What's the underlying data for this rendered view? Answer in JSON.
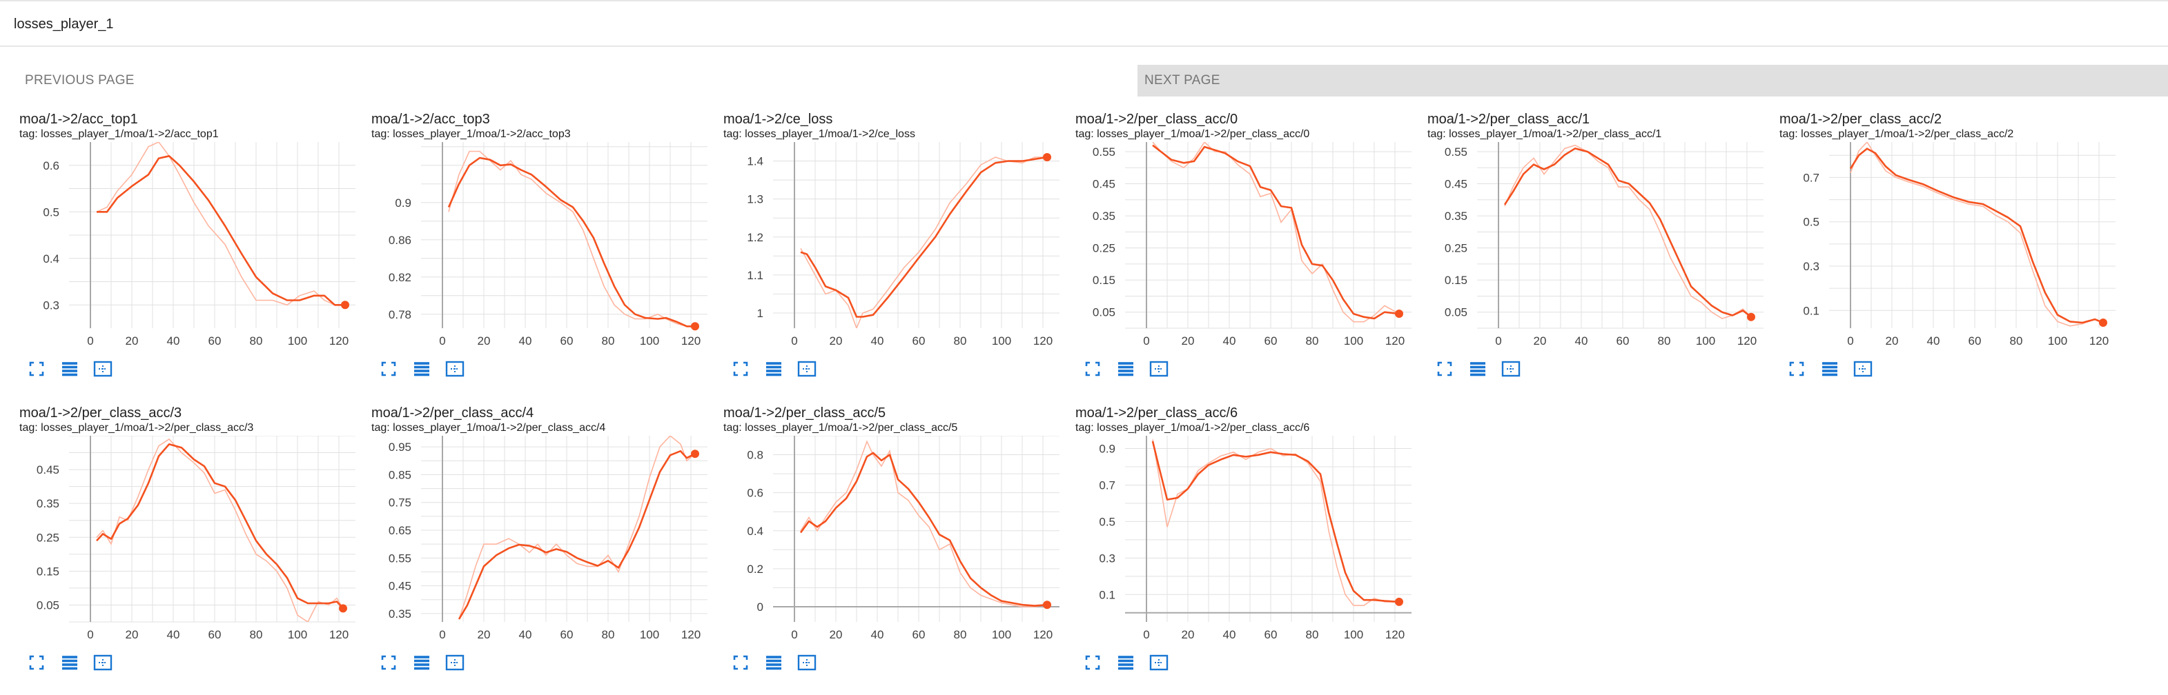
{
  "header": {
    "title": "losses_player_1"
  },
  "pager": {
    "prev_label": "PREVIOUS PAGE",
    "next_label": "NEXT PAGE"
  },
  "colors": {
    "smoothed": "#f4511e",
    "raw": "#ffb59f",
    "grid": "#e0e0e0",
    "axis": "#a8a8a8",
    "icon": "#1976d2"
  },
  "cards": [
    {
      "title": "moa/1->2/acc_top1",
      "tag": "tag: losses_player_1/moa/1->2/acc_top1",
      "icons": [
        "fullscreen-icon",
        "data-list-icon",
        "fit-domain-icon"
      ]
    },
    {
      "title": "moa/1->2/acc_top3",
      "tag": "tag: losses_player_1/moa/1->2/acc_top3",
      "icons": [
        "fullscreen-icon",
        "data-list-icon",
        "fit-domain-icon"
      ]
    },
    {
      "title": "moa/1->2/ce_loss",
      "tag": "tag: losses_player_1/moa/1->2/ce_loss",
      "icons": [
        "fullscreen-icon",
        "data-list-icon",
        "fit-domain-icon"
      ]
    },
    {
      "title": "moa/1->2/per_class_acc/0",
      "tag": "tag: losses_player_1/moa/1->2/per_class_acc/0",
      "icons": [
        "fullscreen-icon",
        "data-list-icon",
        "fit-domain-icon"
      ]
    },
    {
      "title": "moa/1->2/per_class_acc/1",
      "tag": "tag: losses_player_1/moa/1->2/per_class_acc/1",
      "icons": [
        "fullscreen-icon",
        "data-list-icon",
        "fit-domain-icon"
      ]
    },
    {
      "title": "moa/1->2/per_class_acc/2",
      "tag": "tag: losses_player_1/moa/1->2/per_class_acc/2",
      "icons": [
        "fullscreen-icon",
        "data-list-icon",
        "fit-domain-icon"
      ]
    },
    {
      "title": "moa/1->2/per_class_acc/3",
      "tag": "tag: losses_player_1/moa/1->2/per_class_acc/3",
      "icons": [
        "fullscreen-icon",
        "data-list-icon",
        "fit-domain-icon"
      ]
    },
    {
      "title": "moa/1->2/per_class_acc/4",
      "tag": "tag: losses_player_1/moa/1->2/per_class_acc/4",
      "icons": [
        "fullscreen-icon",
        "data-list-icon",
        "fit-domain-icon"
      ]
    },
    {
      "title": "moa/1->2/per_class_acc/5",
      "tag": "tag: losses_player_1/moa/1->2/per_class_acc/5",
      "icons": [
        "fullscreen-icon",
        "data-list-icon",
        "fit-domain-icon"
      ]
    },
    {
      "title": "moa/1->2/per_class_acc/6",
      "tag": "tag: losses_player_1/moa/1->2/per_class_acc/6",
      "icons": [
        "fullscreen-icon",
        "data-list-icon",
        "fit-domain-icon"
      ]
    }
  ],
  "chart_data": [
    {
      "type": "line",
      "title": "moa/1->2/acc_top1",
      "xlim": [
        -7,
        128
      ],
      "ylim": [
        0.25,
        0.65
      ],
      "xticks": [
        0,
        20,
        40,
        60,
        80,
        100,
        120
      ],
      "yticks": [
        0.3,
        0.4,
        0.5,
        0.6
      ],
      "ytick_labels": [
        "0.3",
        "0.4",
        "0.5",
        "0.6"
      ],
      "grid": true,
      "x": [
        3,
        8,
        13,
        20,
        28,
        33,
        38,
        43,
        50,
        57,
        65,
        73,
        80,
        88,
        95,
        101,
        108,
        113,
        118,
        123
      ],
      "smoothed": [
        0.5,
        0.5,
        0.53,
        0.555,
        0.58,
        0.615,
        0.62,
        0.6,
        0.565,
        0.525,
        0.47,
        0.41,
        0.36,
        0.325,
        0.31,
        0.31,
        0.32,
        0.32,
        0.3,
        0.3
      ],
      "raw": [
        0.5,
        0.51,
        0.545,
        0.58,
        0.64,
        0.65,
        0.62,
        0.58,
        0.52,
        0.47,
        0.43,
        0.36,
        0.31,
        0.31,
        0.3,
        0.32,
        0.33,
        0.31,
        0.3,
        0.3
      ]
    },
    {
      "type": "line",
      "title": "moa/1->2/acc_top3",
      "xlim": [
        -7,
        128
      ],
      "ylim": [
        0.765,
        0.965
      ],
      "xticks": [
        0,
        20,
        40,
        60,
        80,
        100,
        120
      ],
      "yticks": [
        0.78,
        0.82,
        0.86,
        0.9
      ],
      "ytick_labels": [
        "0.78",
        "0.82",
        "0.86",
        "0.9"
      ],
      "grid": true,
      "x": [
        3,
        8,
        13,
        18,
        23,
        28,
        33,
        38,
        43,
        50,
        57,
        63,
        68,
        73,
        78,
        83,
        88,
        93,
        98,
        104,
        108,
        113,
        118,
        122
      ],
      "smoothed": [
        0.895,
        0.92,
        0.94,
        0.948,
        0.946,
        0.94,
        0.941,
        0.935,
        0.93,
        0.917,
        0.903,
        0.895,
        0.88,
        0.862,
        0.835,
        0.81,
        0.79,
        0.78,
        0.776,
        0.775,
        0.776,
        0.772,
        0.767,
        0.767
      ],
      "raw": [
        0.89,
        0.93,
        0.955,
        0.955,
        0.945,
        0.935,
        0.945,
        0.93,
        0.925,
        0.91,
        0.9,
        0.89,
        0.87,
        0.84,
        0.81,
        0.79,
        0.78,
        0.775,
        0.775,
        0.78,
        0.775,
        0.77,
        0.767,
        0.767
      ]
    },
    {
      "type": "line",
      "title": "moa/1->2/ce_loss",
      "xlim": [
        -7,
        128
      ],
      "ylim": [
        0.96,
        1.45
      ],
      "xticks": [
        0,
        20,
        40,
        60,
        80,
        100,
        120
      ],
      "yticks": [
        1,
        1.1,
        1.2,
        1.3,
        1.4
      ],
      "ytick_labels": [
        "1",
        "1.1",
        "1.2",
        "1.3",
        "1.4"
      ],
      "grid": true,
      "x": [
        3,
        6,
        10,
        15,
        20,
        26,
        30,
        33,
        38,
        45,
        53,
        60,
        68,
        75,
        83,
        90,
        97,
        103,
        110,
        116,
        122
      ],
      "smoothed": [
        1.16,
        1.155,
        1.12,
        1.07,
        1.06,
        1.04,
        0.99,
        0.99,
        0.995,
        1.04,
        1.095,
        1.145,
        1.2,
        1.26,
        1.32,
        1.37,
        1.395,
        1.4,
        1.4,
        1.405,
        1.41
      ],
      "raw": [
        1.17,
        1.14,
        1.1,
        1.05,
        1.06,
        1.02,
        0.96,
        1.0,
        1.01,
        1.06,
        1.12,
        1.16,
        1.22,
        1.29,
        1.34,
        1.39,
        1.41,
        1.4,
        1.395,
        1.41,
        1.41
      ]
    },
    {
      "type": "line",
      "title": "moa/1->2/per_class_acc/0",
      "xlim": [
        -7,
        128
      ],
      "ylim": [
        0.0,
        0.58
      ],
      "xticks": [
        0,
        20,
        40,
        60,
        80,
        100,
        120
      ],
      "yticks": [
        0.05,
        0.15,
        0.25,
        0.35,
        0.45,
        0.55
      ],
      "ytick_labels": [
        "0.05",
        "0.15",
        "0.25",
        "0.35",
        "0.45",
        "0.55"
      ],
      "grid": true,
      "x": [
        3,
        7,
        12,
        18,
        23,
        28,
        33,
        38,
        44,
        50,
        55,
        60,
        65,
        70,
        75,
        80,
        85,
        90,
        95,
        100,
        105,
        110,
        115,
        122
      ],
      "smoothed": [
        0.57,
        0.55,
        0.525,
        0.515,
        0.52,
        0.565,
        0.555,
        0.545,
        0.52,
        0.505,
        0.44,
        0.43,
        0.38,
        0.375,
        0.26,
        0.2,
        0.195,
        0.15,
        0.09,
        0.045,
        0.035,
        0.03,
        0.05,
        0.045
      ],
      "raw": [
        0.58,
        0.55,
        0.52,
        0.5,
        0.53,
        0.58,
        0.55,
        0.55,
        0.51,
        0.48,
        0.41,
        0.42,
        0.33,
        0.37,
        0.21,
        0.17,
        0.2,
        0.12,
        0.05,
        0.02,
        0.02,
        0.04,
        0.07,
        0.045
      ]
    },
    {
      "type": "line",
      "title": "moa/1->2/per_class_acc/1",
      "xlim": [
        -7,
        128
      ],
      "ylim": [
        0.0,
        0.58
      ],
      "xticks": [
        0,
        20,
        40,
        60,
        80,
        100,
        120
      ],
      "yticks": [
        0.05,
        0.15,
        0.25,
        0.35,
        0.45,
        0.55
      ],
      "ytick_labels": [
        "0.05",
        "0.15",
        "0.25",
        "0.35",
        "0.45",
        "0.55"
      ],
      "grid": true,
      "x": [
        3,
        7,
        12,
        17,
        22,
        27,
        32,
        37,
        43,
        48,
        53,
        58,
        63,
        68,
        73,
        78,
        83,
        88,
        93,
        98,
        103,
        108,
        113,
        118,
        122
      ],
      "smoothed": [
        0.385,
        0.425,
        0.48,
        0.51,
        0.495,
        0.51,
        0.54,
        0.56,
        0.55,
        0.53,
        0.51,
        0.46,
        0.45,
        0.42,
        0.39,
        0.34,
        0.27,
        0.2,
        0.13,
        0.1,
        0.07,
        0.05,
        0.04,
        0.055,
        0.035
      ],
      "raw": [
        0.38,
        0.44,
        0.5,
        0.53,
        0.48,
        0.52,
        0.56,
        0.57,
        0.55,
        0.52,
        0.5,
        0.44,
        0.44,
        0.4,
        0.37,
        0.3,
        0.22,
        0.16,
        0.1,
        0.08,
        0.05,
        0.03,
        0.04,
        0.06,
        0.035
      ]
    },
    {
      "type": "line",
      "title": "moa/1->2/per_class_acc/2",
      "xlim": [
        -7,
        128
      ],
      "ylim": [
        0.02,
        0.86
      ],
      "xticks": [
        0,
        20,
        40,
        60,
        80,
        100,
        120
      ],
      "yticks": [
        0.1,
        0.3,
        0.5,
        0.7
      ],
      "ytick_labels": [
        "0.1",
        "0.3",
        "0.5",
        "0.7"
      ],
      "grid": true,
      "x": [
        0,
        4,
        8,
        12,
        17,
        22,
        28,
        35,
        42,
        50,
        57,
        64,
        70,
        76,
        82,
        88,
        94,
        100,
        106,
        112,
        118,
        122
      ],
      "smoothed": [
        0.74,
        0.8,
        0.83,
        0.81,
        0.75,
        0.71,
        0.69,
        0.67,
        0.64,
        0.61,
        0.59,
        0.58,
        0.55,
        0.52,
        0.48,
        0.32,
        0.18,
        0.08,
        0.05,
        0.045,
        0.06,
        0.045
      ],
      "raw": [
        0.72,
        0.82,
        0.86,
        0.8,
        0.73,
        0.7,
        0.68,
        0.66,
        0.63,
        0.6,
        0.58,
        0.57,
        0.53,
        0.5,
        0.45,
        0.28,
        0.12,
        0.05,
        0.03,
        0.04,
        0.06,
        0.045
      ]
    },
    {
      "type": "line",
      "title": "moa/1->2/per_class_acc/3",
      "xlim": [
        -7,
        128
      ],
      "ylim": [
        0.0,
        0.55
      ],
      "xticks": [
        0,
        20,
        40,
        60,
        80,
        100,
        120
      ],
      "yticks": [
        0.05,
        0.15,
        0.25,
        0.35,
        0.45
      ],
      "ytick_labels": [
        "0.05",
        "0.15",
        "0.25",
        "0.35",
        "0.45"
      ],
      "grid": true,
      "x": [
        3,
        6,
        10,
        14,
        18,
        23,
        28,
        33,
        38,
        44,
        50,
        55,
        60,
        65,
        70,
        75,
        80,
        85,
        90,
        95,
        100,
        105,
        110,
        115,
        119,
        122
      ],
      "smoothed": [
        0.24,
        0.26,
        0.245,
        0.29,
        0.305,
        0.345,
        0.41,
        0.49,
        0.525,
        0.515,
        0.48,
        0.46,
        0.41,
        0.4,
        0.36,
        0.3,
        0.24,
        0.2,
        0.17,
        0.13,
        0.07,
        0.055,
        0.055,
        0.055,
        0.06,
        0.04
      ],
      "raw": [
        0.25,
        0.27,
        0.23,
        0.31,
        0.3,
        0.37,
        0.45,
        0.52,
        0.54,
        0.5,
        0.47,
        0.44,
        0.38,
        0.39,
        0.33,
        0.26,
        0.2,
        0.18,
        0.15,
        0.1,
        0.02,
        0.0,
        0.06,
        0.05,
        0.07,
        0.04
      ]
    },
    {
      "type": "line",
      "title": "moa/1->2/per_class_acc/4",
      "xlim": [
        -7,
        128
      ],
      "ylim": [
        0.32,
        0.99
      ],
      "xticks": [
        0,
        20,
        40,
        60,
        80,
        100,
        120
      ],
      "yticks": [
        0.35,
        0.45,
        0.55,
        0.65,
        0.75,
        0.85,
        0.95
      ],
      "ytick_labels": [
        "0.35",
        "0.45",
        "0.55",
        "0.65",
        "0.75",
        "0.85",
        "0.95"
      ],
      "grid": true,
      "x": [
        8,
        12,
        16,
        20,
        26,
        32,
        37,
        42,
        46,
        50,
        55,
        60,
        65,
        70,
        75,
        80,
        85,
        90,
        95,
        100,
        105,
        110,
        115,
        118,
        122
      ],
      "smoothed": [
        0.33,
        0.38,
        0.45,
        0.52,
        0.56,
        0.585,
        0.598,
        0.594,
        0.585,
        0.57,
        0.582,
        0.572,
        0.55,
        0.535,
        0.522,
        0.54,
        0.515,
        0.58,
        0.66,
        0.76,
        0.86,
        0.92,
        0.935,
        0.91,
        0.925
      ],
      "raw": [
        0.33,
        0.42,
        0.52,
        0.6,
        0.6,
        0.62,
        0.6,
        0.57,
        0.6,
        0.56,
        0.6,
        0.56,
        0.53,
        0.52,
        0.52,
        0.56,
        0.5,
        0.6,
        0.7,
        0.84,
        0.95,
        0.99,
        0.96,
        0.9,
        0.925
      ]
    },
    {
      "type": "line",
      "title": "moa/1->2/per_class_acc/5",
      "xlim": [
        -7,
        128
      ],
      "ylim": [
        -0.08,
        0.9
      ],
      "xticks": [
        0,
        20,
        40,
        60,
        80,
        100,
        120
      ],
      "yticks": [
        0,
        0.2,
        0.4,
        0.6,
        0.8
      ],
      "ytick_labels": [
        "0",
        "0.2",
        "0.4",
        "0.6",
        "0.8"
      ],
      "grid": true,
      "x": [
        3,
        7,
        11,
        15,
        20,
        25,
        30,
        35,
        38,
        42,
        46,
        50,
        55,
        60,
        65,
        70,
        75,
        80,
        85,
        90,
        95,
        100,
        105,
        110,
        116,
        122
      ],
      "smoothed": [
        0.39,
        0.45,
        0.42,
        0.45,
        0.52,
        0.57,
        0.66,
        0.79,
        0.81,
        0.77,
        0.8,
        0.67,
        0.62,
        0.55,
        0.47,
        0.38,
        0.35,
        0.24,
        0.15,
        0.1,
        0.06,
        0.03,
        0.02,
        0.01,
        0.005,
        0.01
      ],
      "raw": [
        0.4,
        0.47,
        0.4,
        0.47,
        0.55,
        0.6,
        0.72,
        0.87,
        0.8,
        0.74,
        0.82,
        0.6,
        0.56,
        0.48,
        0.42,
        0.3,
        0.33,
        0.18,
        0.1,
        0.06,
        0.04,
        0.02,
        0.01,
        0.0,
        0.0,
        0.01
      ]
    },
    {
      "type": "line",
      "title": "moa/1->2/per_class_acc/6",
      "xlim": [
        -7,
        128
      ],
      "ylim": [
        -0.05,
        0.97
      ],
      "xticks": [
        0,
        20,
        40,
        60,
        80,
        100,
        120
      ],
      "yticks": [
        0.1,
        0.3,
        0.5,
        0.7,
        0.9
      ],
      "ytick_labels": [
        "0.1",
        "0.3",
        "0.5",
        "0.7",
        "0.9"
      ],
      "grid": true,
      "x": [
        3,
        6,
        10,
        15,
        20,
        25,
        30,
        36,
        42,
        48,
        54,
        60,
        66,
        72,
        78,
        84,
        88,
        92,
        96,
        100,
        105,
        110,
        115,
        122
      ],
      "smoothed": [
        0.94,
        0.8,
        0.62,
        0.63,
        0.68,
        0.76,
        0.81,
        0.84,
        0.865,
        0.855,
        0.865,
        0.88,
        0.87,
        0.865,
        0.83,
        0.76,
        0.55,
        0.38,
        0.22,
        0.12,
        0.07,
        0.07,
        0.065,
        0.06
      ],
      "raw": [
        0.95,
        0.75,
        0.47,
        0.65,
        0.68,
        0.78,
        0.82,
        0.86,
        0.88,
        0.84,
        0.88,
        0.9,
        0.86,
        0.87,
        0.82,
        0.72,
        0.45,
        0.25,
        0.1,
        0.04,
        0.04,
        0.08,
        0.06,
        0.06
      ]
    }
  ]
}
